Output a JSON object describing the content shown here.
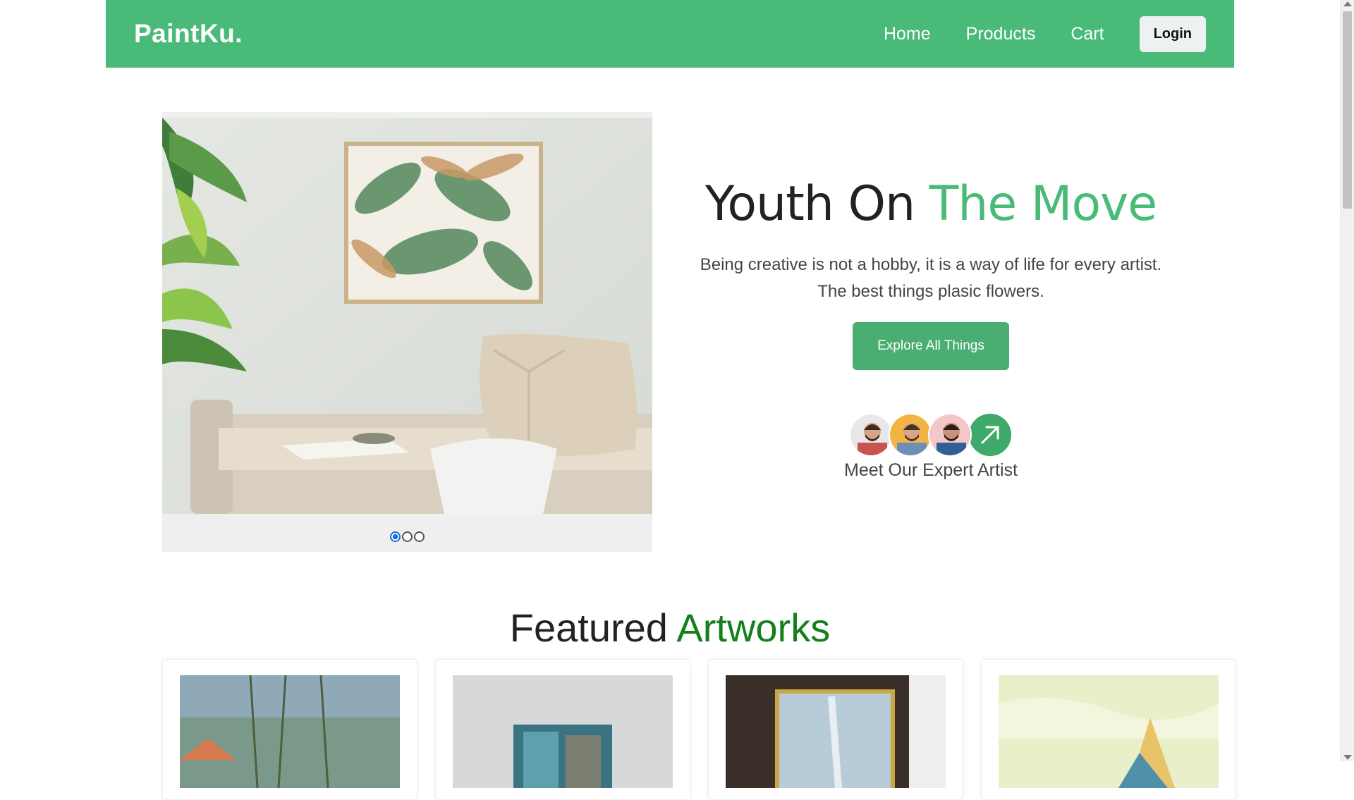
{
  "navbar": {
    "brand": "PaintKu.",
    "links": [
      "Home",
      "Products",
      "Cart"
    ],
    "login_label": "Login"
  },
  "carousel": {
    "slide_count": 3,
    "active_index": 0
  },
  "hero": {
    "title_part1": "Youth On ",
    "title_accent": "The Move",
    "description": "Being creative is not a hobby, it is a way of life for every artist. The best things plasic flowers.",
    "cta_label": "Explore All Things",
    "artists_label": "Meet Our Expert Artist"
  },
  "featured": {
    "title_part1": "Featured ",
    "title_accent": "Artworks",
    "cards": [
      "artwork-1",
      "artwork-2",
      "artwork-3",
      "artwork-4"
    ]
  },
  "colors": {
    "brand_green": "#4aba78",
    "button_green": "#4aad72",
    "accent_dark_green": "#13801a"
  },
  "icons": {
    "arrow": "arrow-up-right-icon"
  }
}
